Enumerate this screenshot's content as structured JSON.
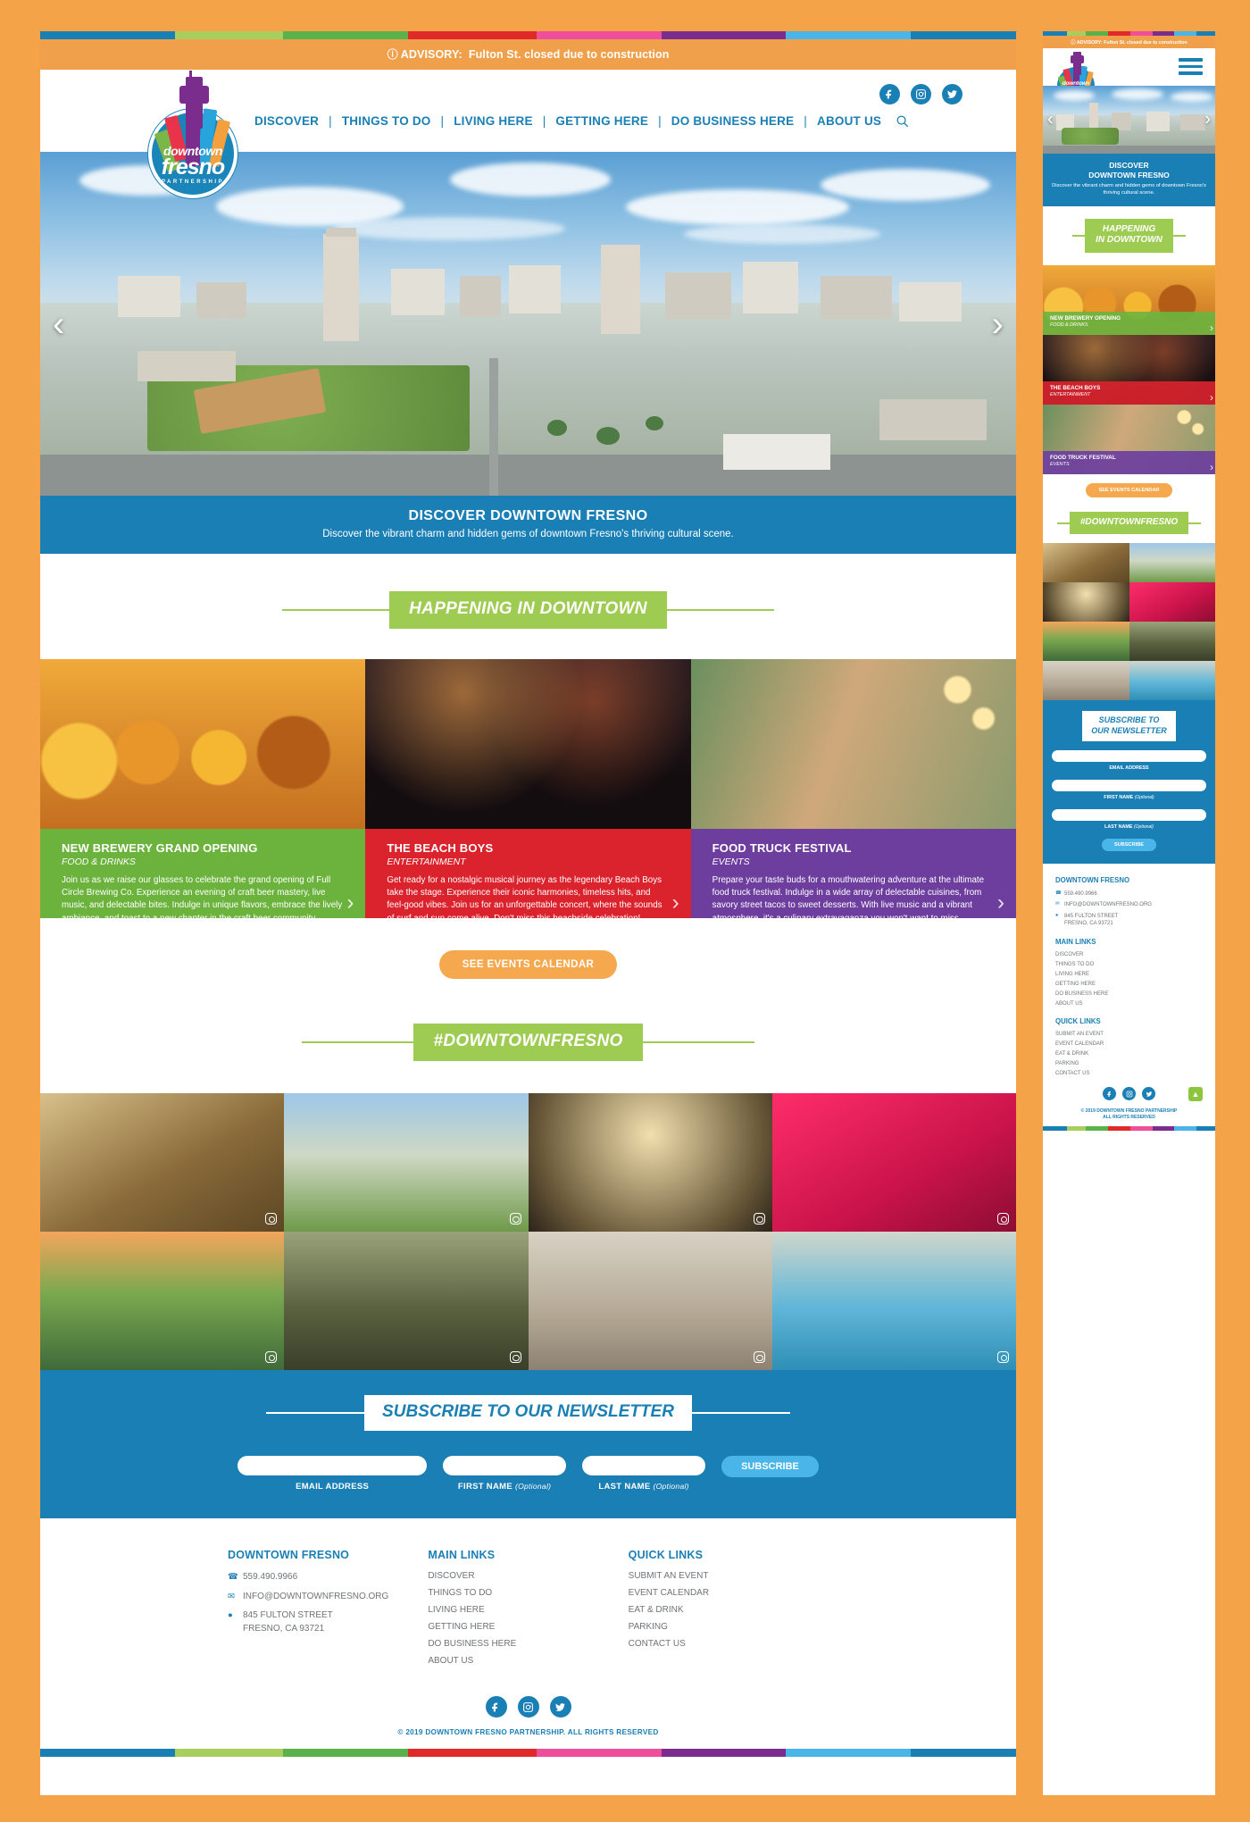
{
  "advisory": {
    "icon": "info-icon",
    "label": "ADVISORY:",
    "text": "Fulton St. closed due to construction"
  },
  "brand": {
    "line1": "downtown",
    "line2": "fresno",
    "line3": "PARTNERSHIP"
  },
  "nav": {
    "items": [
      "DISCOVER",
      "THINGS TO DO",
      "LIVING HERE",
      "GETTING HERE",
      "DO BUSINESS HERE",
      "ABOUT US"
    ],
    "separator": "|",
    "search_icon": "search-icon"
  },
  "social": [
    "facebook-icon",
    "instagram-icon",
    "twitter-icon"
  ],
  "hero": {
    "title": "DISCOVER DOWNTOWN FRESNO",
    "title_mobile_line1": "DISCOVER",
    "title_mobile_line2": "DOWNTOWN FRESNO",
    "subtitle": "Discover the vibrant charm and hidden gems of downtown Fresno's thriving cultural scene.",
    "prev": "‹",
    "next": "›"
  },
  "happening": {
    "heading": "HAPPENING IN DOWNTOWN",
    "heading_mobile_line1": "HAPPENING",
    "heading_mobile_line2": "IN DOWNTOWN",
    "cta": "SEE EVENTS CALENDAR",
    "cards": [
      {
        "title": "NEW BREWERY GRAND OPENING",
        "title_mobile": "NEW BREWERY OPENING",
        "category": "FOOD & DRINKS",
        "description": "Join us as we raise our glasses to celebrate the grand opening of Full Circle Brewing Co. Experience an evening of craft beer mastery, live music, and delectable bites. Indulge in unique flavors, embrace the lively ambiance, and toast to a new chapter in the craft beer community.",
        "color": "#6cb33f",
        "next": "›"
      },
      {
        "title": "THE BEACH BOYS",
        "title_mobile": "THE BEACH BOYS",
        "category": "ENTERTAINMENT",
        "description": "Get ready for a nostalgic musical journey as the legendary Beach Boys take the stage. Experience their iconic harmonies, timeless hits, and feel-good vibes. Join us for an unforgettable concert, where the sounds of surf and sun come alive. Don't miss this beachside celebration!",
        "color": "#d9232e",
        "next": "›"
      },
      {
        "title": "FOOD TRUCK FESTIVAL",
        "title_mobile": "FOOD TRUCK FESTIVAL",
        "category": "EVENTS",
        "description": "Prepare your taste buds for a mouthwatering adventure at the ultimate food truck festival. Indulge in a wide array of delectable cuisines, from savory street tacos to sweet desserts. With live music and a vibrant atmosphere, it's a culinary extravaganza you won't want to miss.",
        "color": "#6d3f9e",
        "next": "›"
      }
    ]
  },
  "hashtag": {
    "heading": "#DOWNTOWNFRESNO",
    "badge_icon": "instagram-icon"
  },
  "newsletter": {
    "heading": "SUBSCRIBE TO OUR NEWSLETTER",
    "heading_mobile_line1": "SUBSCRIBE TO",
    "heading_mobile_line2": "OUR NEWSLETTER",
    "email": {
      "value": "",
      "placeholder": "",
      "label": "EMAIL ADDRESS"
    },
    "first": {
      "value": "",
      "placeholder": "",
      "label": "FIRST NAME",
      "optional": "(Optional)"
    },
    "last": {
      "value": "",
      "placeholder": "",
      "label": "LAST NAME",
      "optional": "(Optional)"
    },
    "submit": "SUBSCRIBE"
  },
  "footer": {
    "contact": {
      "heading": "DOWNTOWN FRESNO",
      "phone": "559.490.9966",
      "email": "INFO@DOWNTOWNFRESNO.ORG",
      "address_line1": "845 FULTON STREET",
      "address_line2": "FRESNO, CA 93721"
    },
    "main_links": {
      "heading": "MAIN LINKS",
      "items": [
        "DISCOVER",
        "THINGS TO DO",
        "LIVING HERE",
        "GETTING HERE",
        "DO BUSINESS HERE",
        "ABOUT US"
      ]
    },
    "quick_links": {
      "heading": "QUICK LINKS",
      "items": [
        "SUBMIT AN EVENT",
        "EVENT CALENDAR",
        "EAT & DRINK",
        "PARKING",
        "CONTACT US"
      ]
    },
    "copyright": "© 2019 DOWNTOWN FRESNO PARTNERSHIP. ALL RIGHTS RESERVED",
    "copyright_mobile_line1": "© 2019 DOWNTOWN FRESNO PARTNERSHIP",
    "copyright_mobile_line2": "ALL RIGHTS RESERVED",
    "back_to_top": "▲"
  },
  "colors": {
    "page_background": "#f5a349",
    "advisory_bg": "#f0a04b",
    "brand_blue": "#1a7fb5",
    "accent_green": "#9ecb52",
    "accent_orange": "#f5a84e",
    "subscribe_blue": "#49b5e8"
  },
  "rainbow": [
    "#1a7fb5",
    "#a8cf5e",
    "#5cb24a",
    "#e02a2a",
    "#ed4f9b",
    "#7b2d8e",
    "#49b5e8",
    "#1a7fb5"
  ]
}
